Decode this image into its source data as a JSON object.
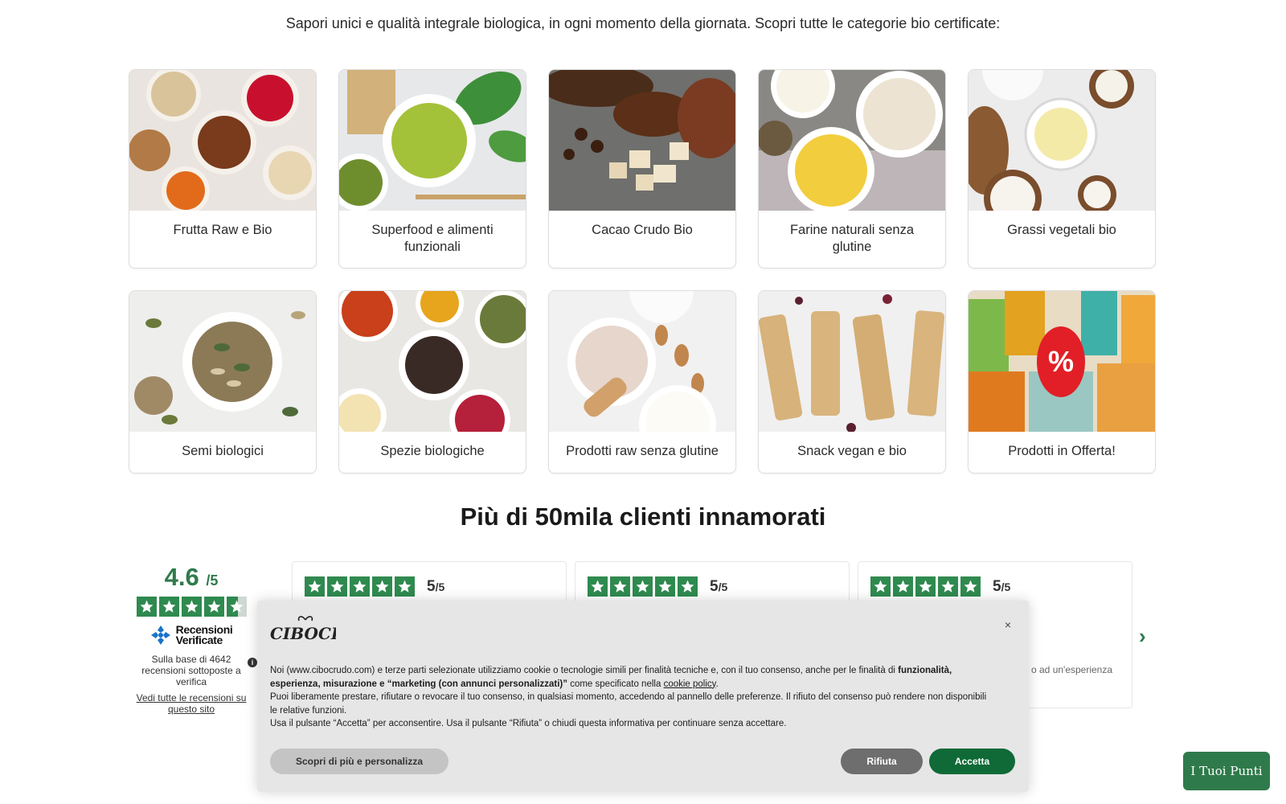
{
  "header": {
    "subtitle": "Sapori unici e qualità integrale biologica, in ogni momento della giornata. Scopri tutte le categorie bio certificate:"
  },
  "categories": [
    {
      "label": "Frutta Raw e Bio",
      "icon": "nuts-dried-fruit-image"
    },
    {
      "label": "Superfood e alimenti funzionali",
      "icon": "matcha-image"
    },
    {
      "label": "Cacao Crudo Bio",
      "icon": "cacao-image"
    },
    {
      "label": "Farine naturali senza glutine",
      "icon": "flours-image"
    },
    {
      "label": "Grassi vegetali bio",
      "icon": "coconut-oil-image"
    },
    {
      "label": "Semi biologici",
      "icon": "seeds-image"
    },
    {
      "label": "Spezie biologiche",
      "icon": "spices-image"
    },
    {
      "label": "Prodotti raw senza glutine",
      "icon": "almond-flour-image"
    },
    {
      "label": "Snack vegan e bio",
      "icon": "granola-bars-image"
    },
    {
      "label": "Prodotti in Offerta!",
      "icon": "offer-packages-image"
    }
  ],
  "reviews_section": {
    "title": "Più di 50mila clienti innamorati",
    "rating_value": "4.6",
    "rating_max": "/5",
    "stars": 4.6,
    "verified_line1": "Recensioni",
    "verified_line2": "Verificate",
    "based_on": "Sulla base di 4642 recensioni sottoposte a verifica",
    "all_reviews_link": "Vedi tutte le recensioni su questo sito",
    "cards": [
      {
        "score": "5",
        "max": "/5",
        "snippet": ""
      },
      {
        "score": "5",
        "max": "/5",
        "snippet": ""
      },
      {
        "score": "5",
        "max": "/5",
        "snippet": "o ad un'esperienza"
      }
    ],
    "next_arrow": "›"
  },
  "cookie_banner": {
    "brand": "CIBOCRUDO",
    "close": "×",
    "p1_pre": "Noi (www.cibocrudo.com) e terze parti selezionate utilizziamo cookie o tecnologie simili per finalità tecniche e, con il tuo consenso, anche per le finalità di ",
    "p1_bold": "funzionalità, esperienza, misurazione e “marketing (con annunci personalizzati)”",
    "p1_mid": " come specificato nella ",
    "p1_link": "cookie policy",
    "p1_end": ".",
    "p2": "Puoi liberamente prestare, rifiutare o revocare il tuo consenso, in qualsiasi momento, accedendo al pannello delle preferenze. Il rifiuto del consenso può rendere non disponibili le relative funzioni.",
    "p3": "Usa il pulsante “Accetta” per acconsentire. Usa il pulsante “Rifiuta” o chiudi questa informativa per continuare senza accettare.",
    "btn_customize": "Scopri di più e personalizza",
    "btn_reject": "Rifiuta",
    "btn_accept": "Accetta"
  },
  "points_button": "I Tuoi Punti",
  "colors": {
    "brand_green": "#2f7a4b",
    "accept_green": "#0f6a37"
  }
}
